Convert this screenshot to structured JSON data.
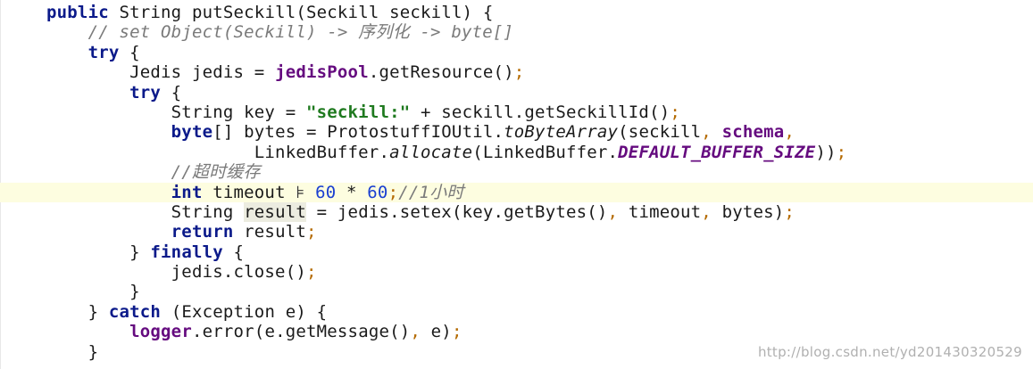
{
  "lines": [
    {
      "indent": 0,
      "tokens": [
        {
          "t": "public ",
          "c": "kw"
        },
        {
          "t": "String ",
          "c": ""
        },
        {
          "t": "putSeckill",
          "c": ""
        },
        {
          "t": "(",
          "c": ""
        },
        {
          "t": "Seckill ",
          "c": ""
        },
        {
          "t": "seckill) {",
          "c": ""
        }
      ]
    },
    {
      "indent": 2,
      "tokens": [
        {
          "t": "// set Object(Seckill) -> 序列化 -> byte[]",
          "c": "comment"
        }
      ]
    },
    {
      "indent": 2,
      "tokens": [
        {
          "t": "try ",
          "c": "kw"
        },
        {
          "t": "{",
          "c": ""
        }
      ]
    },
    {
      "indent": 4,
      "tokens": [
        {
          "t": "Jedis jedis = ",
          "c": ""
        },
        {
          "t": "jedisPool",
          "c": "fld"
        },
        {
          "t": ".getResource()",
          "c": ""
        },
        {
          "t": ";",
          "c": "semi"
        }
      ]
    },
    {
      "indent": 4,
      "tokens": [
        {
          "t": "try ",
          "c": "kw"
        },
        {
          "t": "{",
          "c": ""
        }
      ]
    },
    {
      "indent": 6,
      "tokens": [
        {
          "t": "String key = ",
          "c": ""
        },
        {
          "t": "\"seckill:\"",
          "c": "str"
        },
        {
          "t": " + seckill.getSeckillId()",
          "c": ""
        },
        {
          "t": ";",
          "c": "semi"
        }
      ]
    },
    {
      "indent": 6,
      "tokens": [
        {
          "t": "byte",
          "c": "kw"
        },
        {
          "t": "[] bytes = ProtostuffIOUtil.",
          "c": ""
        },
        {
          "t": "toByteArray",
          "c": "italic-m"
        },
        {
          "t": "(seckill",
          "c": ""
        },
        {
          "t": ", ",
          "c": "semi"
        },
        {
          "t": "schema",
          "c": "fld"
        },
        {
          "t": ",",
          "c": "semi"
        }
      ]
    },
    {
      "indent": 10,
      "tokens": [
        {
          "t": "LinkedBuffer.",
          "c": ""
        },
        {
          "t": "allocate",
          "c": "italic-m"
        },
        {
          "t": "(LinkedBuffer.",
          "c": ""
        },
        {
          "t": "DEFAULT_BUFFER_SIZE",
          "c": "const"
        },
        {
          "t": "))",
          "c": ""
        },
        {
          "t": ";",
          "c": "semi"
        }
      ]
    },
    {
      "indent": 6,
      "tokens": [
        {
          "t": "//超时缓存",
          "c": "comment"
        }
      ]
    },
    {
      "indent": 6,
      "current": true,
      "tokens": [
        {
          "t": "int ",
          "c": "kw"
        },
        {
          "t": "timeout ",
          "c": ""
        },
        {
          "t": "⊧ ",
          "c": "cursor-mark"
        },
        {
          "t": "60",
          "c": "num"
        },
        {
          "t": " * ",
          "c": ""
        },
        {
          "t": "60",
          "c": "num"
        },
        {
          "t": ";",
          "c": "semi"
        },
        {
          "t": "//1小时",
          "c": "comment"
        }
      ]
    },
    {
      "indent": 6,
      "tokens": [
        {
          "t": "String ",
          "c": ""
        },
        {
          "t": "result",
          "c": "hl-var"
        },
        {
          "t": " = jedis.setex(key.getBytes()",
          "c": ""
        },
        {
          "t": ", ",
          "c": "semi"
        },
        {
          "t": "timeout",
          "c": ""
        },
        {
          "t": ", ",
          "c": "semi"
        },
        {
          "t": "bytes)",
          "c": ""
        },
        {
          "t": ";",
          "c": "semi"
        }
      ]
    },
    {
      "indent": 6,
      "tokens": [
        {
          "t": "return ",
          "c": "kw"
        },
        {
          "t": "result",
          "c": ""
        },
        {
          "t": ";",
          "c": "semi"
        }
      ]
    },
    {
      "indent": 4,
      "tokens": [
        {
          "t": "} ",
          "c": ""
        },
        {
          "t": "finally ",
          "c": "kw"
        },
        {
          "t": "{",
          "c": ""
        }
      ]
    },
    {
      "indent": 6,
      "tokens": [
        {
          "t": "jedis.close()",
          "c": ""
        },
        {
          "t": ";",
          "c": "semi"
        }
      ]
    },
    {
      "indent": 4,
      "tokens": [
        {
          "t": "}",
          "c": ""
        }
      ]
    },
    {
      "indent": 2,
      "tokens": [
        {
          "t": "} ",
          "c": ""
        },
        {
          "t": "catch ",
          "c": "kw"
        },
        {
          "t": "(Exception e) {",
          "c": ""
        }
      ]
    },
    {
      "indent": 4,
      "tokens": [
        {
          "t": "logger",
          "c": "fld"
        },
        {
          "t": ".error(e.getMessage()",
          "c": ""
        },
        {
          "t": ", ",
          "c": "semi"
        },
        {
          "t": "e)",
          "c": ""
        },
        {
          "t": ";",
          "c": "semi"
        }
      ]
    },
    {
      "indent": 2,
      "tokens": [
        {
          "t": "}",
          "c": ""
        }
      ]
    }
  ],
  "watermark": "http://blog.csdn.net/yd201430320529"
}
